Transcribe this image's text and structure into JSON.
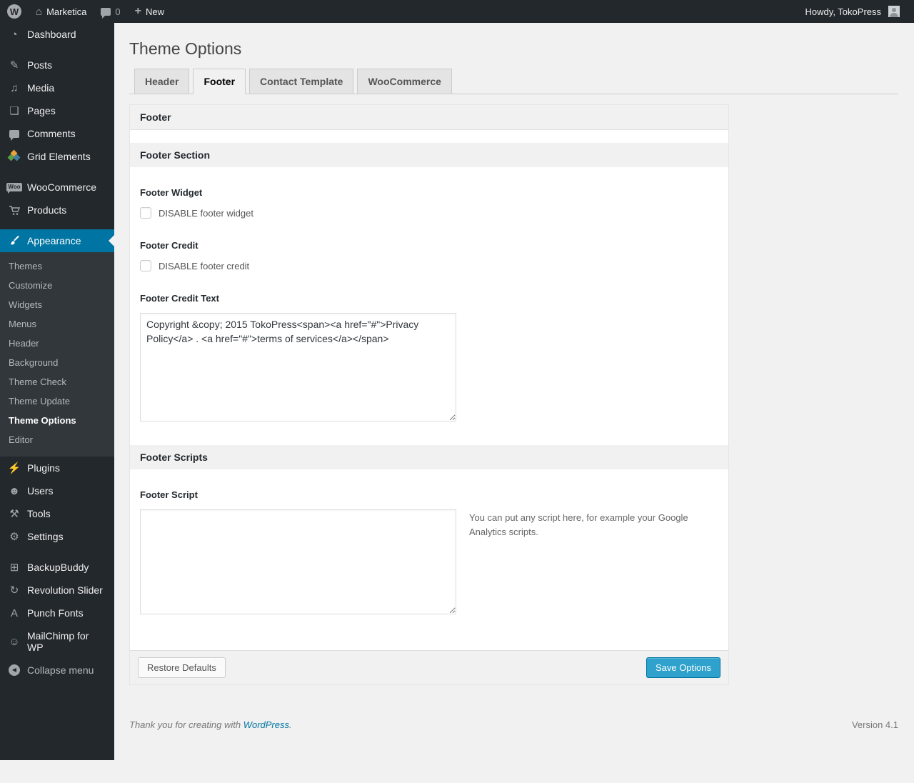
{
  "admin_bar": {
    "site_name": "Marketica",
    "comment_count": "0",
    "new_label": "New",
    "howdy": "Howdy, TokoPress"
  },
  "icons": {
    "wordpress_logo": "W",
    "home": "⌂",
    "new_plus": "+",
    "dashboard": "◔",
    "posts": "✎",
    "media": "♫",
    "pages": "❏",
    "woocommerce_badge": "Woo",
    "plugins": "⚡",
    "users": "☻",
    "tools": "⚒",
    "settings": "⚙",
    "backupbuddy": "⊞",
    "revolution_slider": "↻",
    "punch_fonts": "A",
    "mailchimp": "☺",
    "collapse_arrow": "◀"
  },
  "sidebar": {
    "items": [
      {
        "label": "Dashboard"
      },
      {
        "label": "Posts"
      },
      {
        "label": "Media"
      },
      {
        "label": "Pages"
      },
      {
        "label": "Comments"
      },
      {
        "label": "Grid Elements"
      },
      {
        "label": "WooCommerce"
      },
      {
        "label": "Products"
      },
      {
        "label": "Appearance"
      },
      {
        "label": "Plugins"
      },
      {
        "label": "Users"
      },
      {
        "label": "Tools"
      },
      {
        "label": "Settings"
      },
      {
        "label": "BackupBuddy"
      },
      {
        "label": "Revolution Slider"
      },
      {
        "label": "Punch Fonts"
      },
      {
        "label": "MailChimp for WP"
      }
    ],
    "appearance_submenu": [
      {
        "label": "Themes"
      },
      {
        "label": "Customize"
      },
      {
        "label": "Widgets"
      },
      {
        "label": "Menus"
      },
      {
        "label": "Header"
      },
      {
        "label": "Background"
      },
      {
        "label": "Theme Check"
      },
      {
        "label": "Theme Update"
      },
      {
        "label": "Theme Options",
        "current": true
      },
      {
        "label": "Editor"
      }
    ],
    "collapse_label": "Collapse menu"
  },
  "main": {
    "title": "Theme Options",
    "tabs": [
      {
        "label": "Header",
        "active": false
      },
      {
        "label": "Footer",
        "active": true
      },
      {
        "label": "Contact Template",
        "active": false
      },
      {
        "label": "WooCommerce",
        "active": false
      }
    ],
    "panel": {
      "panel_title": "Footer",
      "footer_section_title": "Footer Section",
      "footer_widget_label": "Footer Widget",
      "footer_widget_checkbox": "DISABLE footer widget",
      "footer_credit_label": "Footer Credit",
      "footer_credit_checkbox": "DISABLE footer credit",
      "footer_credit_text_label": "Footer Credit Text",
      "footer_credit_text_value": "Copyright &copy; 2015 TokoPress<span><a href=\"#\">Privacy Policy</a> . <a href=\"#\">terms of services</a></span>",
      "footer_scripts_title": "Footer Scripts",
      "footer_script_label": "Footer Script",
      "footer_script_value": "",
      "footer_script_help": "You can put any script here, for example your Google Analytics scripts.",
      "restore_button": "Restore Defaults",
      "save_button": "Save Options"
    }
  },
  "page_footer": {
    "thanks_prefix": "Thank you for creating with ",
    "wordpress_link": "WordPress",
    "thanks_suffix": ".",
    "version": "Version 4.1"
  },
  "colors": {
    "accent": "#0074a2",
    "primary_button": "#2ea2cc",
    "admin_dark": "#23282d",
    "page_background": "#f1f1f1"
  }
}
